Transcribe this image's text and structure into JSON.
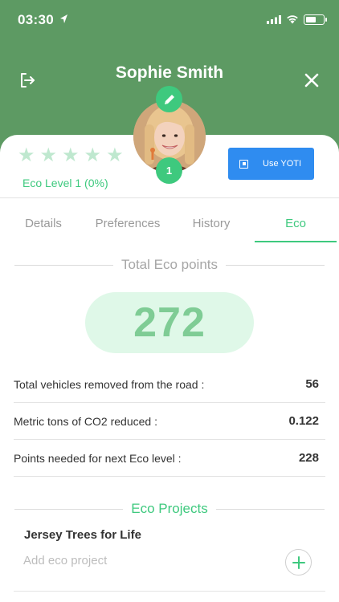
{
  "status_bar": {
    "time": "03:30"
  },
  "header": {
    "user_name": "Sophie Smith"
  },
  "profile": {
    "level_badge": "1",
    "stars_total": 5,
    "stars_filled": 0,
    "eco_level_label": "Eco Level 1 (0%)",
    "yoti_button_label": "Use YOTI"
  },
  "tabs": [
    {
      "label": "Details",
      "active": false
    },
    {
      "label": "Preferences",
      "active": false
    },
    {
      "label": "History",
      "active": false
    },
    {
      "label": "Eco",
      "active": true
    }
  ],
  "eco": {
    "points_heading": "Total Eco points",
    "points_value": "272",
    "stats": [
      {
        "label": "Total vehicles removed from the road :",
        "value": "56"
      },
      {
        "label": "Metric tons of CO2 reduced :",
        "value": "0.122"
      },
      {
        "label": "Points needed for next Eco level :",
        "value": "228"
      }
    ],
    "projects_heading": "Eco Projects",
    "projects": [
      {
        "name": "Jersey Trees for Life"
      }
    ],
    "add_project_placeholder": "Add eco project"
  },
  "colors": {
    "header_green": "#5d9a63",
    "accent_green": "#3ec97e",
    "points_pill_bg": "#dff8e8",
    "points_text": "#7fcc95",
    "yoti_blue": "#2f8cf0"
  },
  "icons": {
    "logout": "logout-icon",
    "close": "close-icon",
    "edit": "pencil-icon",
    "add": "plus-icon",
    "yoti": "yoti-icon"
  }
}
